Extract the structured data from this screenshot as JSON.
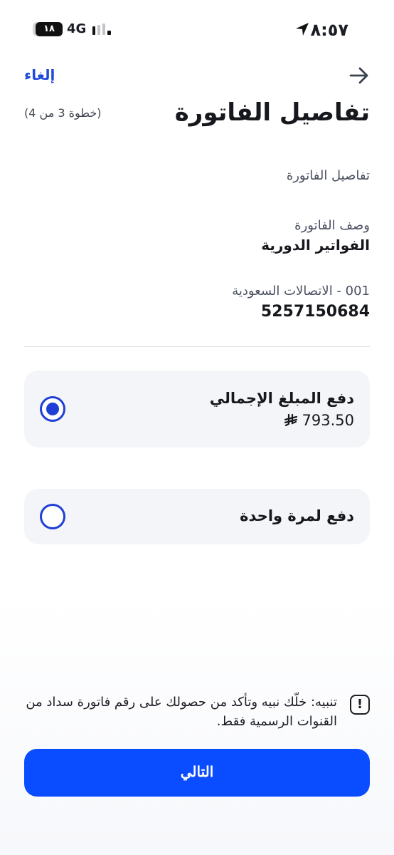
{
  "status_bar": {
    "time": "٨:٥٧",
    "battery": "١٨",
    "network": "4G"
  },
  "header": {
    "cancel_label": "إلغاء",
    "title": "تفاصيل الفاتورة",
    "step": "(خطوة 3 من 4)",
    "back_icon": "arrow-right-icon"
  },
  "details": {
    "section_heading": "تفاصيل الفاتورة",
    "description_label": "وصف الفاتورة",
    "description_value": "الفواتير الدورية",
    "biller_label": "001 - الاتصالات السعودية",
    "biller_account": "5257150684"
  },
  "options": [
    {
      "title": "دفع المبلغ الإجمالي",
      "amount": "793.50",
      "currency_icon": "riyal-icon",
      "selected": true
    },
    {
      "title": "دفع لمرة واحدة",
      "selected": false
    }
  ],
  "warning": {
    "icon": "alert-icon",
    "text": "تنبيه: خلّك نبيه وتأكد من حصولك على رقم فاتورة سداد من القنوات الرسمية فقط."
  },
  "next_button": {
    "label": "التالي"
  },
  "colors": {
    "accent": "#0a4cff",
    "radio": "#1f3fd6",
    "card_bg": "#f3f5f9"
  }
}
